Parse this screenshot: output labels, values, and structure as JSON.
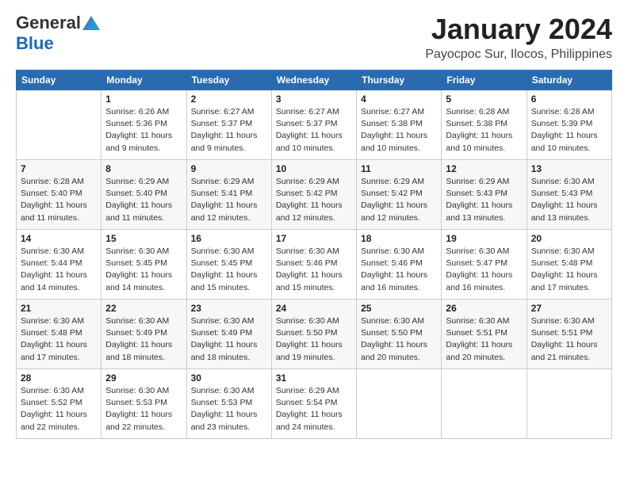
{
  "header": {
    "logo_general": "General",
    "logo_blue": "Blue",
    "title": "January 2024",
    "subtitle": "Payocpoc Sur, Ilocos, Philippines"
  },
  "days_of_week": [
    "Sunday",
    "Monday",
    "Tuesday",
    "Wednesday",
    "Thursday",
    "Friday",
    "Saturday"
  ],
  "weeks": [
    [
      {
        "day": "",
        "info": ""
      },
      {
        "day": "1",
        "info": "Sunrise: 6:26 AM\nSunset: 5:36 PM\nDaylight: 11 hours\nand 9 minutes."
      },
      {
        "day": "2",
        "info": "Sunrise: 6:27 AM\nSunset: 5:37 PM\nDaylight: 11 hours\nand 9 minutes."
      },
      {
        "day": "3",
        "info": "Sunrise: 6:27 AM\nSunset: 5:37 PM\nDaylight: 11 hours\nand 10 minutes."
      },
      {
        "day": "4",
        "info": "Sunrise: 6:27 AM\nSunset: 5:38 PM\nDaylight: 11 hours\nand 10 minutes."
      },
      {
        "day": "5",
        "info": "Sunrise: 6:28 AM\nSunset: 5:38 PM\nDaylight: 11 hours\nand 10 minutes."
      },
      {
        "day": "6",
        "info": "Sunrise: 6:28 AM\nSunset: 5:39 PM\nDaylight: 11 hours\nand 10 minutes."
      }
    ],
    [
      {
        "day": "7",
        "info": "Sunrise: 6:28 AM\nSunset: 5:40 PM\nDaylight: 11 hours\nand 11 minutes."
      },
      {
        "day": "8",
        "info": "Sunrise: 6:29 AM\nSunset: 5:40 PM\nDaylight: 11 hours\nand 11 minutes."
      },
      {
        "day": "9",
        "info": "Sunrise: 6:29 AM\nSunset: 5:41 PM\nDaylight: 11 hours\nand 12 minutes."
      },
      {
        "day": "10",
        "info": "Sunrise: 6:29 AM\nSunset: 5:42 PM\nDaylight: 11 hours\nand 12 minutes."
      },
      {
        "day": "11",
        "info": "Sunrise: 6:29 AM\nSunset: 5:42 PM\nDaylight: 11 hours\nand 12 minutes."
      },
      {
        "day": "12",
        "info": "Sunrise: 6:29 AM\nSunset: 5:43 PM\nDaylight: 11 hours\nand 13 minutes."
      },
      {
        "day": "13",
        "info": "Sunrise: 6:30 AM\nSunset: 5:43 PM\nDaylight: 11 hours\nand 13 minutes."
      }
    ],
    [
      {
        "day": "14",
        "info": "Sunrise: 6:30 AM\nSunset: 5:44 PM\nDaylight: 11 hours\nand 14 minutes."
      },
      {
        "day": "15",
        "info": "Sunrise: 6:30 AM\nSunset: 5:45 PM\nDaylight: 11 hours\nand 14 minutes."
      },
      {
        "day": "16",
        "info": "Sunrise: 6:30 AM\nSunset: 5:45 PM\nDaylight: 11 hours\nand 15 minutes."
      },
      {
        "day": "17",
        "info": "Sunrise: 6:30 AM\nSunset: 5:46 PM\nDaylight: 11 hours\nand 15 minutes."
      },
      {
        "day": "18",
        "info": "Sunrise: 6:30 AM\nSunset: 5:46 PM\nDaylight: 11 hours\nand 16 minutes."
      },
      {
        "day": "19",
        "info": "Sunrise: 6:30 AM\nSunset: 5:47 PM\nDaylight: 11 hours\nand 16 minutes."
      },
      {
        "day": "20",
        "info": "Sunrise: 6:30 AM\nSunset: 5:48 PM\nDaylight: 11 hours\nand 17 minutes."
      }
    ],
    [
      {
        "day": "21",
        "info": "Sunrise: 6:30 AM\nSunset: 5:48 PM\nDaylight: 11 hours\nand 17 minutes."
      },
      {
        "day": "22",
        "info": "Sunrise: 6:30 AM\nSunset: 5:49 PM\nDaylight: 11 hours\nand 18 minutes."
      },
      {
        "day": "23",
        "info": "Sunrise: 6:30 AM\nSunset: 5:49 PM\nDaylight: 11 hours\nand 18 minutes."
      },
      {
        "day": "24",
        "info": "Sunrise: 6:30 AM\nSunset: 5:50 PM\nDaylight: 11 hours\nand 19 minutes."
      },
      {
        "day": "25",
        "info": "Sunrise: 6:30 AM\nSunset: 5:50 PM\nDaylight: 11 hours\nand 20 minutes."
      },
      {
        "day": "26",
        "info": "Sunrise: 6:30 AM\nSunset: 5:51 PM\nDaylight: 11 hours\nand 20 minutes."
      },
      {
        "day": "27",
        "info": "Sunrise: 6:30 AM\nSunset: 5:51 PM\nDaylight: 11 hours\nand 21 minutes."
      }
    ],
    [
      {
        "day": "28",
        "info": "Sunrise: 6:30 AM\nSunset: 5:52 PM\nDaylight: 11 hours\nand 22 minutes."
      },
      {
        "day": "29",
        "info": "Sunrise: 6:30 AM\nSunset: 5:53 PM\nDaylight: 11 hours\nand 22 minutes."
      },
      {
        "day": "30",
        "info": "Sunrise: 6:30 AM\nSunset: 5:53 PM\nDaylight: 11 hours\nand 23 minutes."
      },
      {
        "day": "31",
        "info": "Sunrise: 6:29 AM\nSunset: 5:54 PM\nDaylight: 11 hours\nand 24 minutes."
      },
      {
        "day": "",
        "info": ""
      },
      {
        "day": "",
        "info": ""
      },
      {
        "day": "",
        "info": ""
      }
    ]
  ]
}
